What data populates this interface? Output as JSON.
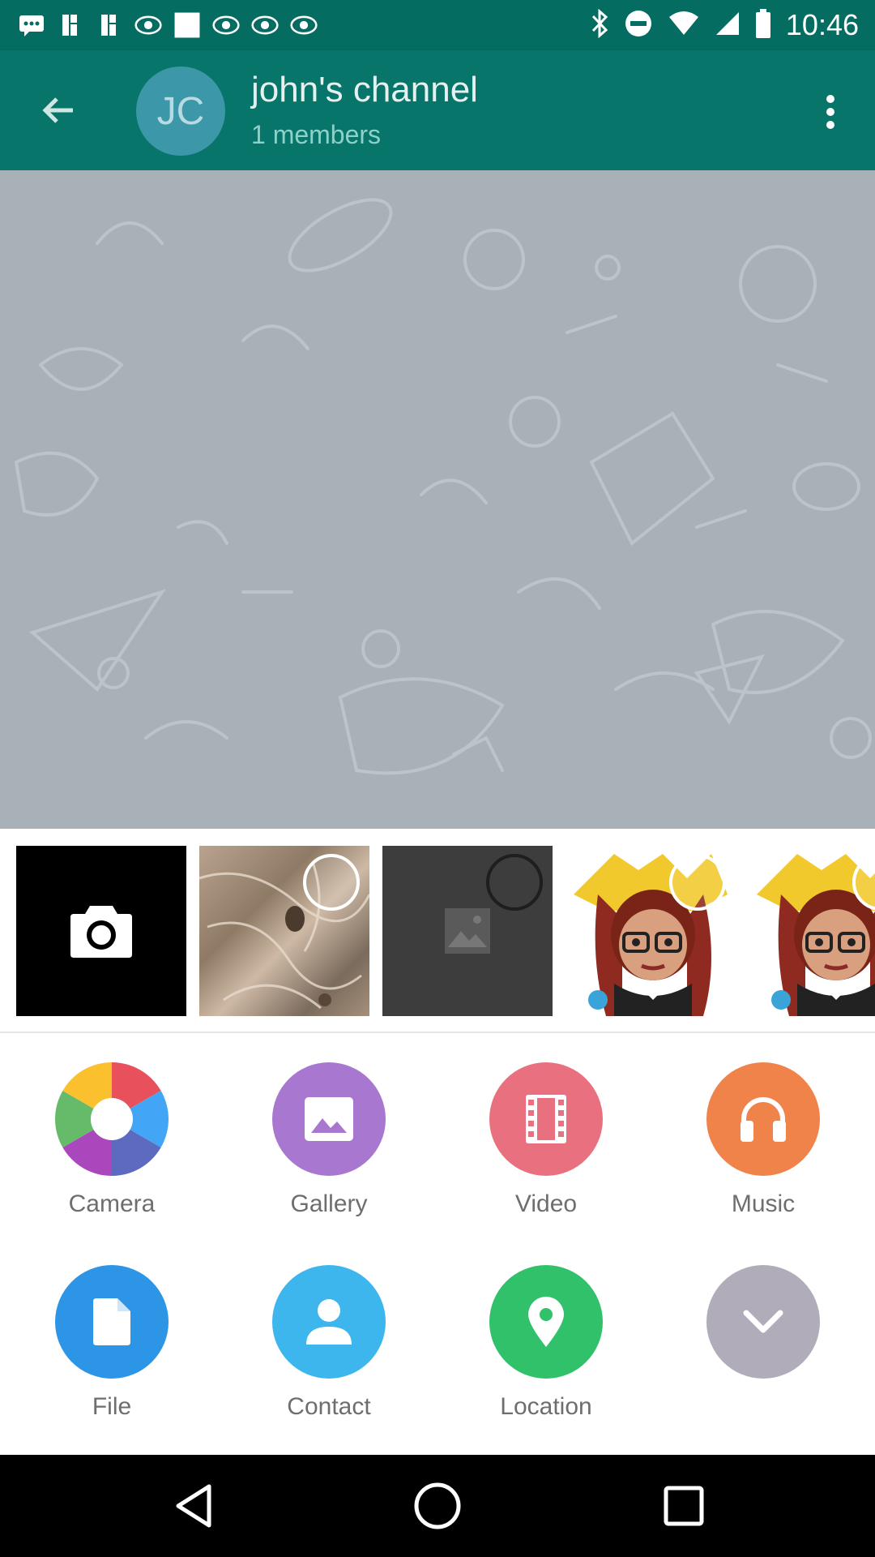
{
  "status_bar": {
    "time": "10:46",
    "icons": [
      "messages-icon",
      "slack-icon",
      "slack-icon",
      "news-icon",
      "blank-card-icon",
      "news-icon",
      "news-icon",
      "news-icon",
      "bluetooth-icon",
      "do-not-disturb-icon",
      "wifi-icon",
      "cell-signal-icon",
      "battery-icon"
    ]
  },
  "header": {
    "avatar_initials": "JC",
    "title": "john's channel",
    "subtitle": "1 members"
  },
  "attach": {
    "thumbnails": [
      "camera-thumb",
      "photo-rock",
      "photo-placeholder",
      "sticker-amazing",
      "sticker-amazing"
    ],
    "actions": [
      {
        "label": "Camera",
        "icon": "camera-aperture-icon",
        "color": "multi"
      },
      {
        "label": "Gallery",
        "icon": "image-icon",
        "color": "#a877d0"
      },
      {
        "label": "Video",
        "icon": "film-icon",
        "color": "#e9717f"
      },
      {
        "label": "Music",
        "icon": "headphones-icon",
        "color": "#f0834a"
      },
      {
        "label": "File",
        "icon": "file-icon",
        "color": "#2d95e5"
      },
      {
        "label": "Contact",
        "icon": "person-icon",
        "color": "#3db6ee"
      },
      {
        "label": "Location",
        "icon": "location-pin-icon",
        "color": "#31c16a"
      },
      {
        "label": "",
        "icon": "chevron-down-icon",
        "color": "#b0acba"
      }
    ]
  },
  "colors": {
    "status_bar": "#056c62",
    "app_bar": "#07756a",
    "chat_background": "#a9b1b8"
  }
}
